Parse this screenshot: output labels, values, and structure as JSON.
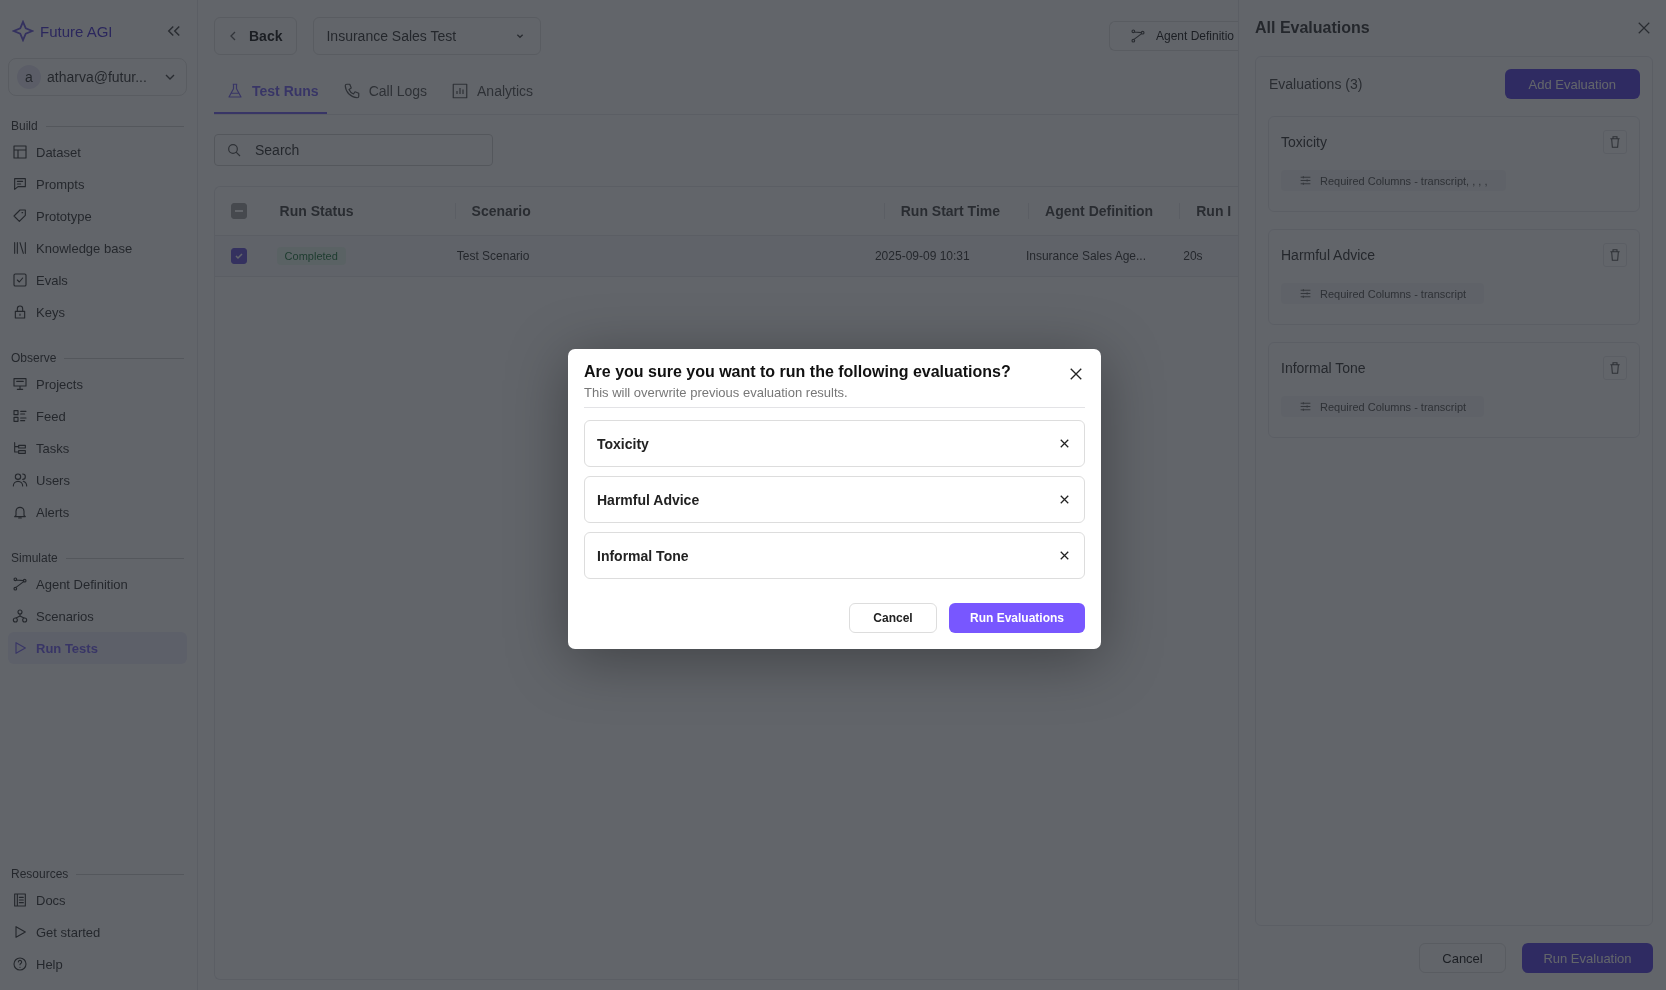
{
  "sidebar": {
    "logo": "Future AGI",
    "user": {
      "avatar": "a",
      "email": "atharva@futur..."
    },
    "sections": [
      {
        "title": "Build",
        "items": [
          {
            "label": "Dataset",
            "selected": false
          },
          {
            "label": "Prompts",
            "selected": false
          },
          {
            "label": "Prototype",
            "selected": false
          },
          {
            "label": "Knowledge base",
            "selected": false
          },
          {
            "label": "Evals",
            "selected": false
          },
          {
            "label": "Keys",
            "selected": false
          }
        ]
      },
      {
        "title": "Observe",
        "items": [
          {
            "label": "Projects",
            "selected": false
          },
          {
            "label": "Feed",
            "selected": false
          },
          {
            "label": "Tasks",
            "selected": false
          },
          {
            "label": "Users",
            "selected": false
          },
          {
            "label": "Alerts",
            "selected": false
          }
        ]
      },
      {
        "title": "Simulate",
        "items": [
          {
            "label": "Agent Definition",
            "selected": false
          },
          {
            "label": "Scenarios",
            "selected": false
          },
          {
            "label": "Run Tests",
            "selected": true
          }
        ]
      }
    ],
    "resources": {
      "title": "Resources",
      "items": [
        {
          "label": "Docs",
          "selected": false
        },
        {
          "label": "Get started",
          "selected": false
        },
        {
          "label": "Help",
          "selected": false
        }
      ]
    }
  },
  "topbar": {
    "back": "Back",
    "project": "Insurance Sales Test",
    "agent_button": "Agent Definitio"
  },
  "tabs": [
    {
      "label": "Test Runs",
      "selected": true
    },
    {
      "label": "Call Logs",
      "selected": false
    },
    {
      "label": "Analytics",
      "selected": false
    }
  ],
  "search": {
    "placeholder": "Search"
  },
  "table": {
    "select_all_partial": true,
    "columns": [
      "Run Status",
      "Scenario",
      "Run Start Time",
      "Agent Definition",
      "Run I"
    ],
    "rows": [
      {
        "checked": true,
        "status": "Completed",
        "scenario": "Test Scenario",
        "start": "2025-09-09 10:31",
        "agent": "Insurance Sales Age...",
        "duration": "20s"
      }
    ]
  },
  "drawer": {
    "title": "All Evaluations",
    "count": "Evaluations (3)",
    "add": "Add Evaluation",
    "evaluations": [
      {
        "name": "Toxicity",
        "required": "Required Columns - transcript, , , ,"
      },
      {
        "name": "Harmful Advice",
        "required": "Required Columns - transcript"
      },
      {
        "name": "Informal Tone",
        "required": "Required Columns - transcript"
      }
    ],
    "cancel": "Cancel",
    "run": "Run Evaluation"
  },
  "modal": {
    "title": "Are you sure you want to run the following evaluations?",
    "subtitle": "This will overwrite previous evaluation results.",
    "items": [
      "Toxicity",
      "Harmful Advice",
      "Informal Tone"
    ],
    "cancel": "Cancel",
    "confirm": "Run Evaluations"
  }
}
